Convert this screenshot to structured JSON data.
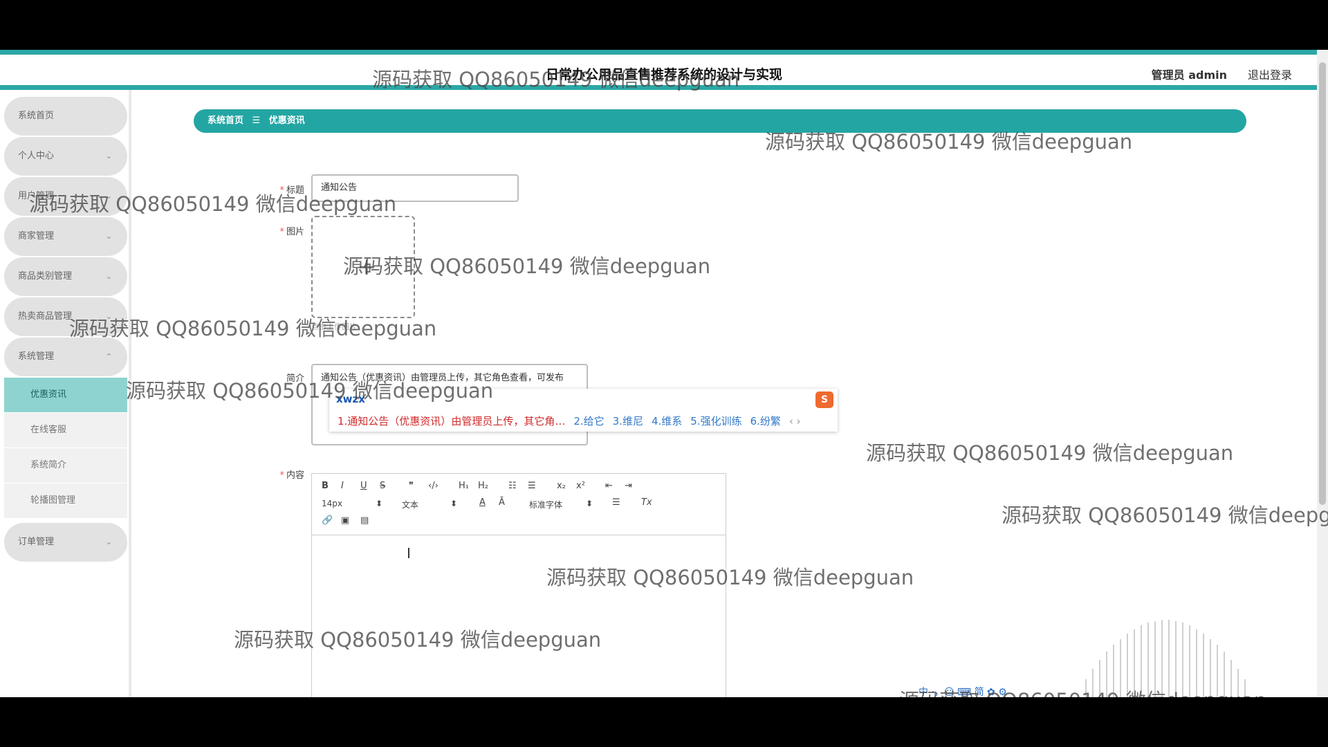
{
  "header": {
    "title": "日常办公用品直售推荐系统的设计与实现",
    "user": "管理员 admin",
    "logout": "退出登录"
  },
  "sidebar": {
    "items": [
      {
        "label": "系统首页",
        "chevron": ""
      },
      {
        "label": "个人中心",
        "chevron": "⌄"
      },
      {
        "label": "用户管理",
        "chevron": "⌄"
      },
      {
        "label": "商家管理",
        "chevron": "⌄"
      },
      {
        "label": "商品类别管理",
        "chevron": "⌄"
      },
      {
        "label": "热卖商品管理",
        "chevron": "⌄"
      },
      {
        "label": "系统管理",
        "chevron": "⌃"
      },
      {
        "label": "订单管理",
        "chevron": "⌄"
      }
    ],
    "submenu": [
      "优惠资讯",
      "在线客服",
      "系统简介",
      "轮播图管理"
    ]
  },
  "breadcrumb": {
    "home": "系统首页",
    "sep": "☰",
    "current": "优惠资讯"
  },
  "form": {
    "title_label": "标题",
    "title_value": "通知公告",
    "image_label": "图片",
    "upload_plus": "+",
    "upload_hint": "点击上传图片",
    "intro_label": "简介",
    "intro_value": "通知公告（优惠资讯）由管理员上传，其它角色查看，可发布",
    "content_label": "内容",
    "required_mark": "*"
  },
  "ime": {
    "code": "xwzx",
    "first": "1.通知公告（优惠资讯）由管理员上传，其它角…",
    "candidates": [
      "2.给它",
      "3.维尼",
      "4.维系",
      "5.强化训练",
      "6.纷繁"
    ],
    "arrows": "‹ ›"
  },
  "editor": {
    "bold": "B",
    "italic": "I",
    "underline": "U",
    "strike": "S",
    "quote": "❞",
    "code": "‹/›",
    "h1": "H₁",
    "h2": "H₂",
    "ol": "☷",
    "ul": "☰",
    "sub": "x₂",
    "sup": "x²",
    "outdent": "⇤",
    "indent": "⇥",
    "size": "14px",
    "format": "文本",
    "color": "A",
    "bg": "Ā",
    "font": "标准字体",
    "align": "☰",
    "clear": "Tx",
    "link": "🔗",
    "image": "▣",
    "video": "▤",
    "arrow": "⬍"
  },
  "watermark_text": "源码获取 QQ86050149 微信deepguan",
  "tray_text": "中 ·，☺ ⌨ 简 ✿ ⚙",
  "colors": {
    "accent": "#23a6a3",
    "active_sub": "#8fd3d0",
    "pill": "#e2e2e2"
  }
}
